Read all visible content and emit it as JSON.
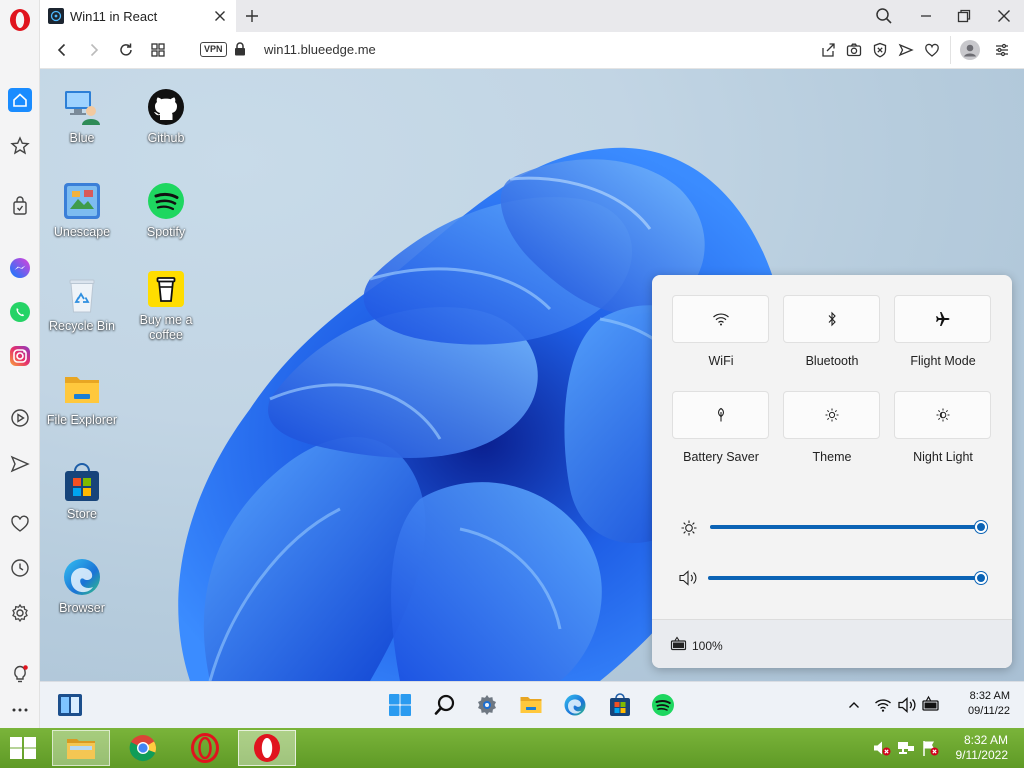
{
  "browser": {
    "tab_title": "Win11 in React",
    "url": "win11.blueedge.me",
    "vpn_label": "VPN"
  },
  "desktop_icons": [
    {
      "label": "Blue",
      "icon": "user-computer-icon"
    },
    {
      "label": "Github",
      "icon": "github-icon"
    },
    {
      "label": "Unescape",
      "icon": "unescape-icon"
    },
    {
      "label": "Spotify",
      "icon": "spotify-icon"
    },
    {
      "label": "Recycle Bin",
      "icon": "recycle-bin-icon"
    },
    {
      "label": "Buy me a coffee",
      "icon": "coffee-icon"
    },
    {
      "label": "File Explorer",
      "icon": "folder-icon"
    },
    {
      "label": "Store",
      "icon": "store-icon"
    },
    {
      "label": "Browser",
      "icon": "edge-icon"
    }
  ],
  "quick_settings": {
    "tiles": [
      {
        "label": "WiFi",
        "icon": "wifi-icon"
      },
      {
        "label": "Bluetooth",
        "icon": "bluetooth-icon"
      },
      {
        "label": "Flight Mode",
        "icon": "airplane-icon"
      },
      {
        "label": "Battery Saver",
        "icon": "battery-saver-icon"
      },
      {
        "label": "Theme",
        "icon": "theme-icon"
      },
      {
        "label": "Night Light",
        "icon": "night-light-icon"
      }
    ],
    "brightness": 1.0,
    "volume": 1.0,
    "battery": "100%"
  },
  "taskbar": {
    "time": "8:32 AM",
    "date": "09/11/22"
  },
  "host_taskbar": {
    "time": "8:32 AM",
    "date": "9/11/2022"
  },
  "colors": {
    "accent": "#0b63b5",
    "host_taskbar": "#6aa62e",
    "opera_red": "#e0141e"
  }
}
